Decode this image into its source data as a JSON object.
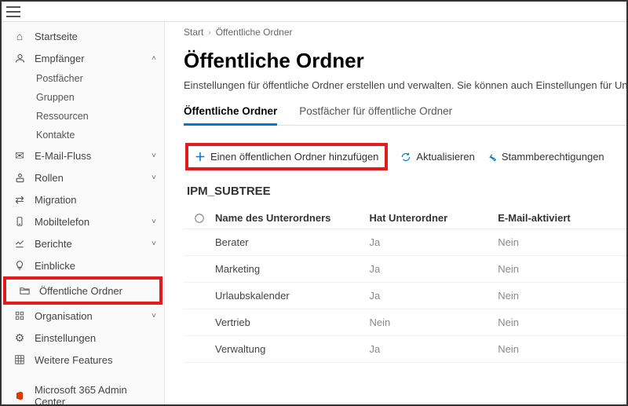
{
  "breadcrumb": {
    "root": "Start",
    "current": "Öffentliche Ordner"
  },
  "page": {
    "title": "Öffentliche Ordner",
    "description": "Einstellungen für öffentliche Ordner erstellen und verwalten. Sie können auch Einstellungen für Unterordner hinzufügen,"
  },
  "tabs": {
    "public_folders": "Öffentliche Ordner",
    "mailboxes": "Postfächer für öffentliche Ordner"
  },
  "toolbar": {
    "add": "Einen öffentlichen Ordner hinzufügen",
    "refresh": "Aktualisieren",
    "root_perms": "Stammberechtigungen"
  },
  "subtree": "IPM_SUBTREE",
  "table": {
    "headers": {
      "name": "Name des Unterordners",
      "has_sub": "Hat Unterordner",
      "mail": "E-Mail-aktiviert"
    },
    "rows": [
      {
        "name": "Berater",
        "has_sub": "Ja",
        "mail": "Nein"
      },
      {
        "name": "Marketing",
        "has_sub": "Ja",
        "mail": "Nein"
      },
      {
        "name": "Urlaubskalender",
        "has_sub": "Ja",
        "mail": "Nein"
      },
      {
        "name": "Vertrieb",
        "has_sub": "Nein",
        "mail": "Nein"
      },
      {
        "name": "Verwaltung",
        "has_sub": "Ja",
        "mail": "Nein"
      }
    ]
  },
  "sidebar": {
    "home": "Startseite",
    "recipients": {
      "label": "Empfänger",
      "children": {
        "mailboxes": "Postfächer",
        "groups": "Gruppen",
        "resources": "Ressourcen",
        "contacts": "Kontakte"
      }
    },
    "mailflow": "E-Mail-Fluss",
    "roles": "Rollen",
    "migration": "Migration",
    "mobile": "Mobiltelefon",
    "reports": "Berichte",
    "insights": "Einblicke",
    "public_folders": "Öffentliche Ordner",
    "organization": "Organisation",
    "settings": "Einstellungen",
    "features": "Weitere Features",
    "m365": "Microsoft 365 Admin Center"
  }
}
